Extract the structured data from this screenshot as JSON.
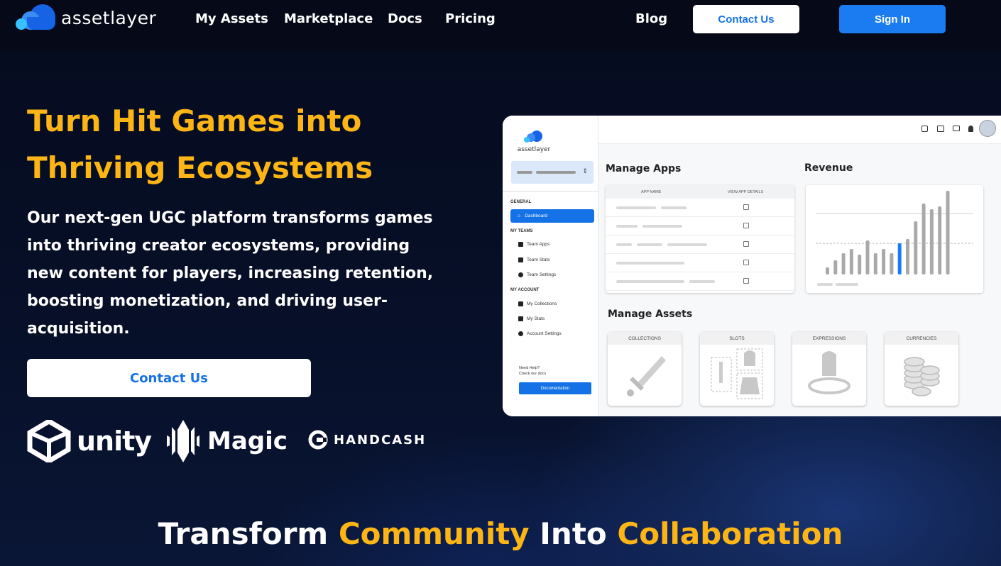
{
  "brand": {
    "name_a": "asset",
    "name_b": "layer"
  },
  "nav": {
    "items": [
      "My Assets",
      "Marketplace",
      "Docs",
      "Pricing"
    ],
    "blog": "Blog",
    "contact": "Contact Us",
    "signin": "Sign In"
  },
  "hero": {
    "title_line1": "Turn Hit Games into",
    "title_line2": "Thriving Ecosystems",
    "subtitle": "Our next-gen UGC platform transforms games into thriving creator ecosystems, providing new content for players, increasing retention, boosting monetization, and driving user-acquisition.",
    "cta": "Contact Us"
  },
  "partners": [
    "unity",
    "Magic",
    "HANDCASH"
  ],
  "dashboard": {
    "brand": "assetlayer",
    "sidebar": {
      "general": "GENERAL",
      "dashboard": "Dashboard",
      "my_teams": "MY TEAMS",
      "team_apps": "Team Apps",
      "team_stats": "Team Stats",
      "team_settings": "Team Settings",
      "my_account": "MY ACCOUNT",
      "my_collections": "My Collections",
      "my_stats": "My Stats",
      "account_settings": "Account Settings",
      "help": "Need Help?",
      "help_sub": "Check our docs",
      "documentation": "Documentation"
    },
    "manage_apps": "Manage Apps",
    "app_name_header": "APP NAME",
    "view_details_header": "VIEW APP DETAILS",
    "revenue": "Revenue",
    "revenue_bars": [
      10,
      20,
      30,
      36,
      28,
      48,
      30,
      36,
      30,
      44,
      50,
      75,
      100,
      92,
      96,
      118
    ],
    "revenue_highlight_index": 9,
    "manage_assets": "Manage Assets",
    "asset_cards": [
      "COLLECTIONS",
      "SLOTS",
      "EXPRESSIONS",
      "CURRENCIES"
    ]
  },
  "bottom": {
    "w1": "Transform",
    "w2": "Community",
    "w3": "Into",
    "w4": "Collaboration"
  },
  "colors": {
    "accent_yellow": "#fcb515",
    "accent_blue": "#1a7cf0",
    "background": "#060c22"
  }
}
